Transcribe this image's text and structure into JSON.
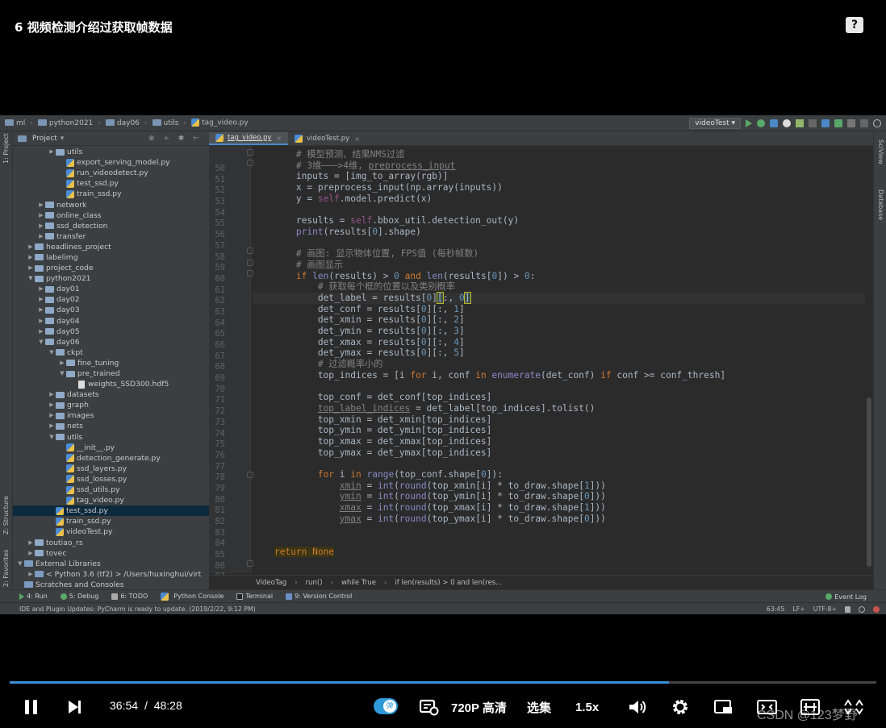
{
  "video_title": "6 视频检测介绍过获取帧数据",
  "help_icon": "?",
  "ide": {
    "breadcrumb": [
      "ml",
      "python2021",
      "day06",
      "utils",
      "tag_video.py"
    ],
    "run_config": "videoTest",
    "project_header": "Project",
    "left_tools": [
      "1: Project",
      "Z: Structure",
      "2: Favorites"
    ],
    "right_tools": [
      "SciView",
      "Database"
    ],
    "tree": [
      {
        "label": "utils",
        "depth": 3,
        "type": "folder",
        "arrow": "▶"
      },
      {
        "label": "export_serving_model.py",
        "depth": 4,
        "type": "py",
        "arrow": ""
      },
      {
        "label": "run_videodetect.py",
        "depth": 4,
        "type": "py",
        "arrow": ""
      },
      {
        "label": "test_ssd.py",
        "depth": 4,
        "type": "py",
        "arrow": ""
      },
      {
        "label": "train_ssd.py",
        "depth": 4,
        "type": "py",
        "arrow": ""
      },
      {
        "label": "network",
        "depth": 2,
        "type": "folder",
        "arrow": "▶"
      },
      {
        "label": "online_class",
        "depth": 2,
        "type": "folder",
        "arrow": "▶"
      },
      {
        "label": "ssd_detection",
        "depth": 2,
        "type": "folder",
        "arrow": "▶"
      },
      {
        "label": "transfer",
        "depth": 2,
        "type": "folder",
        "arrow": "▶"
      },
      {
        "label": "headlines_project",
        "depth": 1,
        "type": "folder",
        "arrow": "▶"
      },
      {
        "label": "labelimg",
        "depth": 1,
        "type": "folder",
        "arrow": "▶"
      },
      {
        "label": "project_code",
        "depth": 1,
        "type": "folder",
        "arrow": "▶"
      },
      {
        "label": "python2021",
        "depth": 1,
        "type": "folder",
        "arrow": "▼"
      },
      {
        "label": "day01",
        "depth": 2,
        "type": "folder",
        "arrow": "▶"
      },
      {
        "label": "day02",
        "depth": 2,
        "type": "folder",
        "arrow": "▶"
      },
      {
        "label": "day03",
        "depth": 2,
        "type": "folder",
        "arrow": "▶"
      },
      {
        "label": "day04",
        "depth": 2,
        "type": "folder",
        "arrow": "▶"
      },
      {
        "label": "day05",
        "depth": 2,
        "type": "folder",
        "arrow": "▶"
      },
      {
        "label": "day06",
        "depth": 2,
        "type": "folder",
        "arrow": "▼"
      },
      {
        "label": "ckpt",
        "depth": 3,
        "type": "folder",
        "arrow": "▼"
      },
      {
        "label": "fine_tuning",
        "depth": 4,
        "type": "folder",
        "arrow": "▶"
      },
      {
        "label": "pre_trained",
        "depth": 4,
        "type": "folder",
        "arrow": "▼"
      },
      {
        "label": "weights_SSD300.hdf5",
        "depth": 5,
        "type": "file",
        "arrow": ""
      },
      {
        "label": "datasets",
        "depth": 3,
        "type": "folder",
        "arrow": "▶"
      },
      {
        "label": "graph",
        "depth": 3,
        "type": "folder",
        "arrow": "▶"
      },
      {
        "label": "images",
        "depth": 3,
        "type": "folder",
        "arrow": "▶"
      },
      {
        "label": "nets",
        "depth": 3,
        "type": "folder",
        "arrow": "▶"
      },
      {
        "label": "utils",
        "depth": 3,
        "type": "folder",
        "arrow": "▼"
      },
      {
        "label": "__init__.py",
        "depth": 4,
        "type": "py",
        "arrow": ""
      },
      {
        "label": "detection_generate.py",
        "depth": 4,
        "type": "py",
        "arrow": ""
      },
      {
        "label": "ssd_layers.py",
        "depth": 4,
        "type": "py",
        "arrow": ""
      },
      {
        "label": "ssd_losses.py",
        "depth": 4,
        "type": "py",
        "arrow": ""
      },
      {
        "label": "ssd_utils.py",
        "depth": 4,
        "type": "py",
        "arrow": ""
      },
      {
        "label": "tag_video.py",
        "depth": 4,
        "type": "py",
        "arrow": ""
      },
      {
        "label": "test_ssd.py",
        "depth": 3,
        "type": "py",
        "arrow": "",
        "selected": true
      },
      {
        "label": "train_ssd.py",
        "depth": 3,
        "type": "py",
        "arrow": ""
      },
      {
        "label": "videoTest.py",
        "depth": 3,
        "type": "py",
        "arrow": ""
      },
      {
        "label": "toutiao_rs",
        "depth": 1,
        "type": "folder",
        "arrow": "▶"
      },
      {
        "label": "tovec",
        "depth": 1,
        "type": "folder",
        "arrow": "▶"
      },
      {
        "label": "External Libraries",
        "depth": 0,
        "type": "lib",
        "arrow": "▼"
      },
      {
        "label": "< Python 3.6 (tf2) >  /Users/huxinghui/virt",
        "depth": 1,
        "type": "lib",
        "arrow": "▶"
      },
      {
        "label": "Scratches and Consoles",
        "depth": 0,
        "type": "lib",
        "arrow": ""
      }
    ],
    "tabs": [
      {
        "label": "tag_video.py",
        "active": true
      },
      {
        "label": "videoTest.py",
        "active": false
      }
    ],
    "line_numbers": [
      "50",
      "51",
      "52",
      "53",
      "54",
      "55",
      "56",
      "57",
      "58",
      "59",
      "60",
      "61",
      "62",
      "63",
      "64",
      "65",
      "66",
      "67",
      "68",
      "69",
      "70",
      "71",
      "72",
      "73",
      "74",
      "75",
      "76",
      "77",
      "78",
      "79",
      "80",
      "81",
      "82",
      "83",
      "84",
      "85",
      "86",
      "87",
      "88"
    ],
    "editor_crumbs": [
      "VideoTag",
      "run()",
      "while True",
      "if len(results) > 0 and len(res..."
    ],
    "bottom_tools": [
      "4: Run",
      "5: Debug",
      "6: TODO",
      "Python Console",
      "Terminal",
      "9: Version Control"
    ],
    "event_log": "Event Log",
    "status_message": "IDE and Plugin Updates: PyCharm is ready to update. (2019/2/22, 9:12 PM)",
    "status_right": [
      "63:45",
      "LF÷",
      "UTF-8÷"
    ]
  },
  "player": {
    "current_time": "36:54",
    "time_sep": "/",
    "duration": "48:28",
    "progress": 0.761,
    "danmu_label": "弹",
    "quality": "720P 高清",
    "episodes": "选集",
    "speed": "1.5x",
    "watermark": "CSDN @123梦野"
  },
  "colors": {
    "accent": "#3a8fd6",
    "editor_bg": "#2b2b2b",
    "panel_bg": "#3c3f41"
  }
}
